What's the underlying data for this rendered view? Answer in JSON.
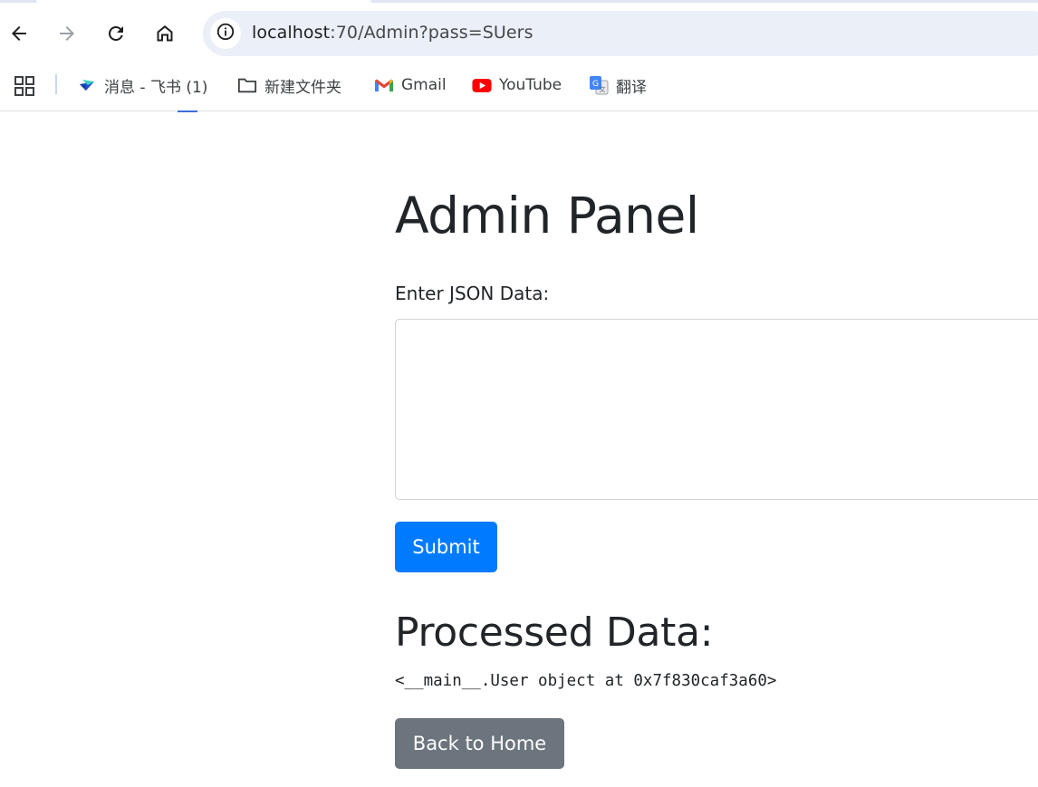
{
  "browser": {
    "url": {
      "host": "localhost",
      "rest": ":70/Admin?pass=SUers"
    },
    "nav_icons": [
      "back-arrow-icon",
      "forward-arrow-icon",
      "reload-icon",
      "home-icon"
    ],
    "bookmarks": [
      {
        "label": "消息 - 飞书 (1)",
        "icon": "feishu-icon"
      },
      {
        "label": "新建文件夹",
        "icon": "folder-icon"
      },
      {
        "label": "Gmail",
        "icon": "gmail-icon"
      },
      {
        "label": "YouTube",
        "icon": "youtube-icon"
      },
      {
        "label": "翻译",
        "icon": "google-translate-icon"
      }
    ]
  },
  "page": {
    "title": "Admin Panel",
    "form": {
      "label": "Enter JSON Data:",
      "input_value": "",
      "submit_label": "Submit"
    },
    "result": {
      "heading": "Processed Data:",
      "output": "<__main__.User object at 0x7f830caf3a60>"
    },
    "back_label": "Back to Home"
  },
  "colors": {
    "primary": "#007bff",
    "secondary": "#6c757d",
    "text": "#212529",
    "omnibox": "#eaeff8"
  }
}
